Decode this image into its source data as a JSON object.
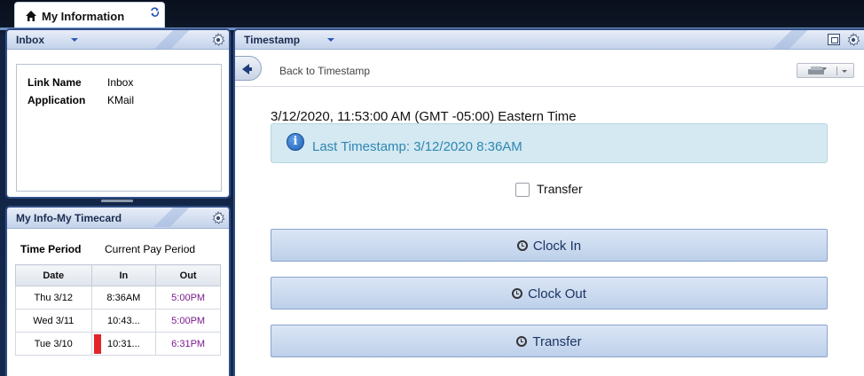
{
  "top_tab": {
    "title": "My Information"
  },
  "inbox_panel": {
    "title": "Inbox",
    "fields": [
      {
        "label": "Link Name",
        "value": "Inbox"
      },
      {
        "label": "Application",
        "value": "KMail"
      }
    ]
  },
  "timecard_panel": {
    "title": "My Info-My Timecard",
    "period_label": "Time Period",
    "period_value": "Current Pay Period",
    "columns": [
      "Date",
      "In",
      "Out"
    ],
    "rows": [
      {
        "date": "Thu 3/12",
        "in": "8:36AM",
        "out": "5:00PM",
        "flag": false
      },
      {
        "date": "Wed 3/11",
        "in": "10:43...",
        "out": "5:00PM",
        "flag": false
      },
      {
        "date": "Tue 3/10",
        "in": "10:31...",
        "out": "6:31PM",
        "flag": true
      }
    ]
  },
  "timestamp_panel": {
    "title": "Timestamp",
    "back_label": "Back to Timestamp",
    "current_datetime": "3/12/2020, 11:53:00 AM (GMT -05:00) Eastern Time",
    "info_message": "Last Timestamp: 3/12/2020 8:36AM",
    "transfer_checkbox_label": "Transfer",
    "transfer_checked": false,
    "buttons": {
      "clock_in": "Clock In",
      "clock_out": "Clock Out",
      "transfer": "Transfer"
    }
  },
  "colors": {
    "panel_border": "#2f4e86",
    "info_bg": "#d4e9f1",
    "out_time": "#7a1b8c",
    "flag": "#e3252a"
  }
}
